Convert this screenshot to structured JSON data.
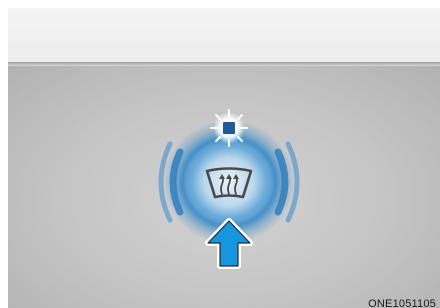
{
  "image_code": "ONE1051105",
  "colors": {
    "background": "#ffffff",
    "panel_gray": "#c4c4c4",
    "indicator_light": "#1e5a9a",
    "glow_blue": "#2e86c8",
    "arrow_blue": "#1596df",
    "arrow_outline": "#ffffff"
  },
  "icons": {
    "indicator": "indicator-light-icon",
    "rear_defroster": "rear-window-defroster-icon",
    "press_arrow": "up-arrow-icon"
  }
}
